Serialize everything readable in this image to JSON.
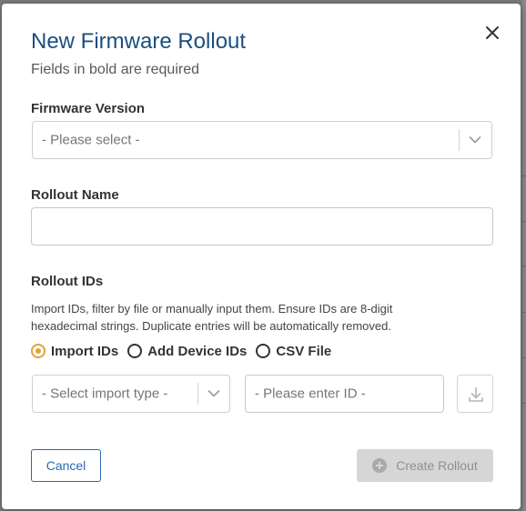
{
  "dialog": {
    "title": "New Firmware Rollout",
    "subtitle": "Fields in bold are required",
    "close_icon": "close-icon"
  },
  "firmware_version": {
    "label": "Firmware Version",
    "placeholder": "- Please select -"
  },
  "rollout_name": {
    "label": "Rollout Name",
    "value": ""
  },
  "rollout_ids": {
    "label": "Rollout IDs",
    "description": "Import IDs, filter by file or manually input them. Ensure IDs are 8-digit hexadecimal strings. Duplicate entries will be automatically removed.",
    "options": [
      {
        "label": "Import IDs",
        "selected": true
      },
      {
        "label": "Add Device IDs",
        "selected": false
      },
      {
        "label": "CSV File",
        "selected": false
      }
    ],
    "import_type_placeholder": "- Select import type -",
    "id_placeholder": "- Please enter ID -",
    "download_icon": "download-icon"
  },
  "footer": {
    "cancel_label": "Cancel",
    "create_label": "Create Rollout",
    "create_enabled": false
  },
  "colors": {
    "title": "#1c4e80",
    "accent_radio": "#e0a23b",
    "primary_link": "#2a6ab3",
    "disabled_bg": "#d6d6d6"
  }
}
